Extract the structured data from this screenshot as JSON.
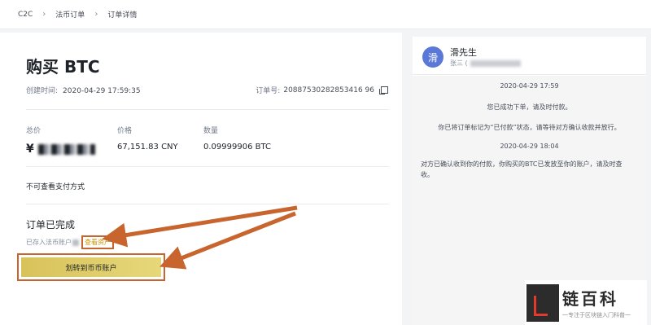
{
  "breadcrumb": [
    "C2C",
    "法币订单",
    "订单详情"
  ],
  "order": {
    "title": "购买 BTC",
    "created_label": "创建时间:",
    "created_value": "2020-04-29 17:59:35",
    "orderno_label": "订单号:",
    "orderno_value": "20887530282853416 96",
    "total_label": "总价",
    "total_prefix": "¥",
    "price_label": "价格",
    "price_value": "67,151.83 CNY",
    "qty_label": "数量",
    "qty_value": "0.09999906 BTC",
    "no_payment": "不可查看支付方式",
    "status_title": "订单已完成",
    "status_sub": "已存入法币账户",
    "view_assets": "查看资产",
    "transfer_button": "划转到币币账户"
  },
  "chat": {
    "avatar_char": "滑",
    "name": "滑先生",
    "sub_prefix": "张三 (",
    "messages": [
      {
        "kind": "time",
        "text": "2020-04-29 17:59"
      },
      {
        "kind": "system",
        "text": "您已成功下单，请及时付款。"
      },
      {
        "kind": "system",
        "text": "你已将订单标记为“已付款”状态，请等待对方确认收款并放行。"
      },
      {
        "kind": "time",
        "text": "2020-04-29 18:04"
      },
      {
        "kind": "left",
        "text": "对方已确认收到你的付款，你购买的BTC已发放至你的账户，请及时查收。"
      }
    ]
  },
  "watermark": {
    "title": "链百科",
    "subtitle": "一专注于区块链入门科普一"
  },
  "colors": {
    "accent": "#f0b90b",
    "annotation": "#c8642d",
    "avatar": "#5a78d8"
  }
}
